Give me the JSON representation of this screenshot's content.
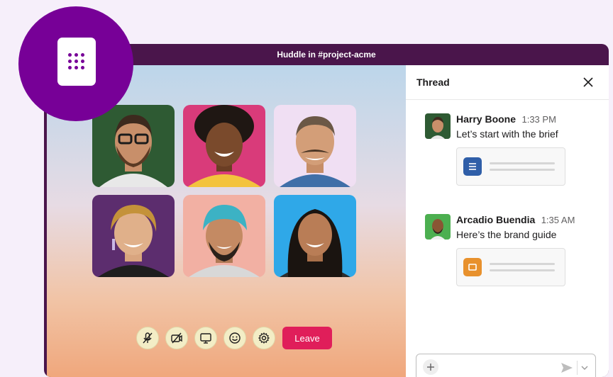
{
  "window": {
    "title": "Huddle in #project-acme"
  },
  "participants": [
    {
      "name": "participant-1",
      "bg": "#2e5a33"
    },
    {
      "name": "participant-2",
      "bg": "#d93b7a"
    },
    {
      "name": "participant-3",
      "bg": "#f0dff3"
    },
    {
      "name": "participant-4",
      "bg": "#5c2d6e"
    },
    {
      "name": "participant-5",
      "bg": "#f2b0a3"
    },
    {
      "name": "participant-6",
      "bg": "#2fa8e8"
    }
  ],
  "controls": {
    "buttons": [
      {
        "name": "mute-mic-icon"
      },
      {
        "name": "video-off-icon"
      },
      {
        "name": "screen-share-icon"
      },
      {
        "name": "emoji-icon"
      },
      {
        "name": "settings-icon"
      }
    ],
    "leave_label": "Leave"
  },
  "thread": {
    "title": "Thread",
    "messages": [
      {
        "author": "Harry Boone",
        "time": "1:33 PM",
        "text": "Let’s start with the brief",
        "attachment": {
          "icon": "document-icon",
          "color": "#2f5ea8"
        }
      },
      {
        "author": "Arcadio Buendia",
        "time": "1:35 AM",
        "text": "Here’s the brand guide",
        "attachment": {
          "icon": "presentation-icon",
          "color": "#e8912d"
        }
      }
    ]
  },
  "colors": {
    "brand": "#4a154b",
    "accent": "#770097",
    "leave": "#e01e5a"
  }
}
